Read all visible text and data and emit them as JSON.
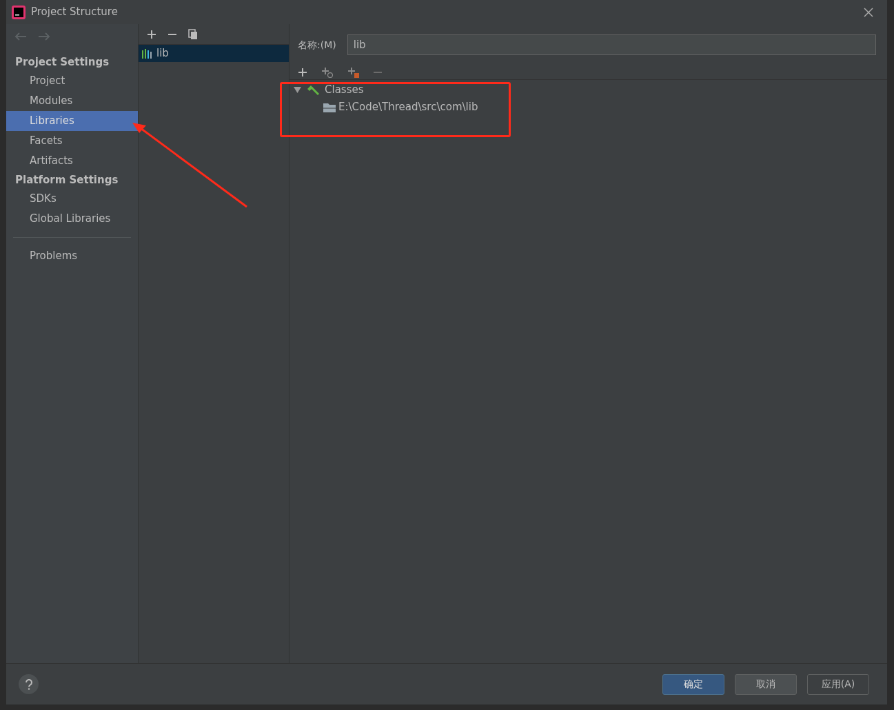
{
  "window": {
    "title": "Project Structure"
  },
  "sidebar": {
    "groups": [
      {
        "title": "Project Settings",
        "items": [
          {
            "label": "Project",
            "selected": false
          },
          {
            "label": "Modules",
            "selected": false
          },
          {
            "label": "Libraries",
            "selected": true
          },
          {
            "label": "Facets",
            "selected": false
          },
          {
            "label": "Artifacts",
            "selected": false
          }
        ]
      },
      {
        "title": "Platform Settings",
        "items": [
          {
            "label": "SDKs",
            "selected": false
          },
          {
            "label": "Global Libraries",
            "selected": false
          }
        ]
      }
    ],
    "footer_items": [
      {
        "label": "Problems",
        "selected": false
      }
    ]
  },
  "libraries": [
    {
      "label": "lib",
      "selected": true
    }
  ],
  "name_field": {
    "label": "名称:(M)",
    "value": "lib"
  },
  "tree": [
    {
      "label": "Classes",
      "expanded": true,
      "children": [
        {
          "label": "E:\\Code\\Thread\\src\\com\\lib"
        }
      ]
    }
  ],
  "buttons": [
    {
      "label": "确定",
      "kind": "default",
      "disabled": false
    },
    {
      "label": "取消",
      "kind": "normal",
      "disabled": false
    },
    {
      "label": "应用(A)",
      "kind": "normal",
      "disabled": true
    }
  ]
}
